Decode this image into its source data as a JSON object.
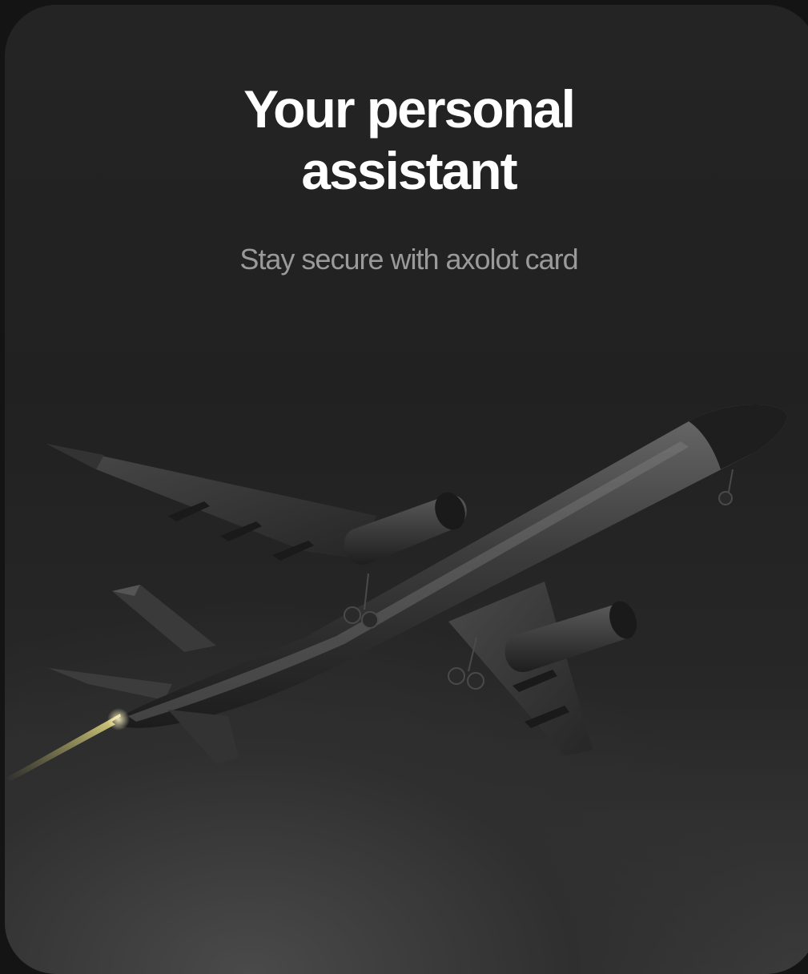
{
  "card": {
    "title_line1": "Your personal",
    "title_line2": "assistant",
    "subtitle": "Stay secure with axolot card",
    "hero_icon": "airplane-icon"
  },
  "colors": {
    "page_background": "#141414",
    "card_background": "#222222",
    "title": "#ffffff",
    "subtitle": "#9a9a9a",
    "contrail": "#d9d27a"
  }
}
